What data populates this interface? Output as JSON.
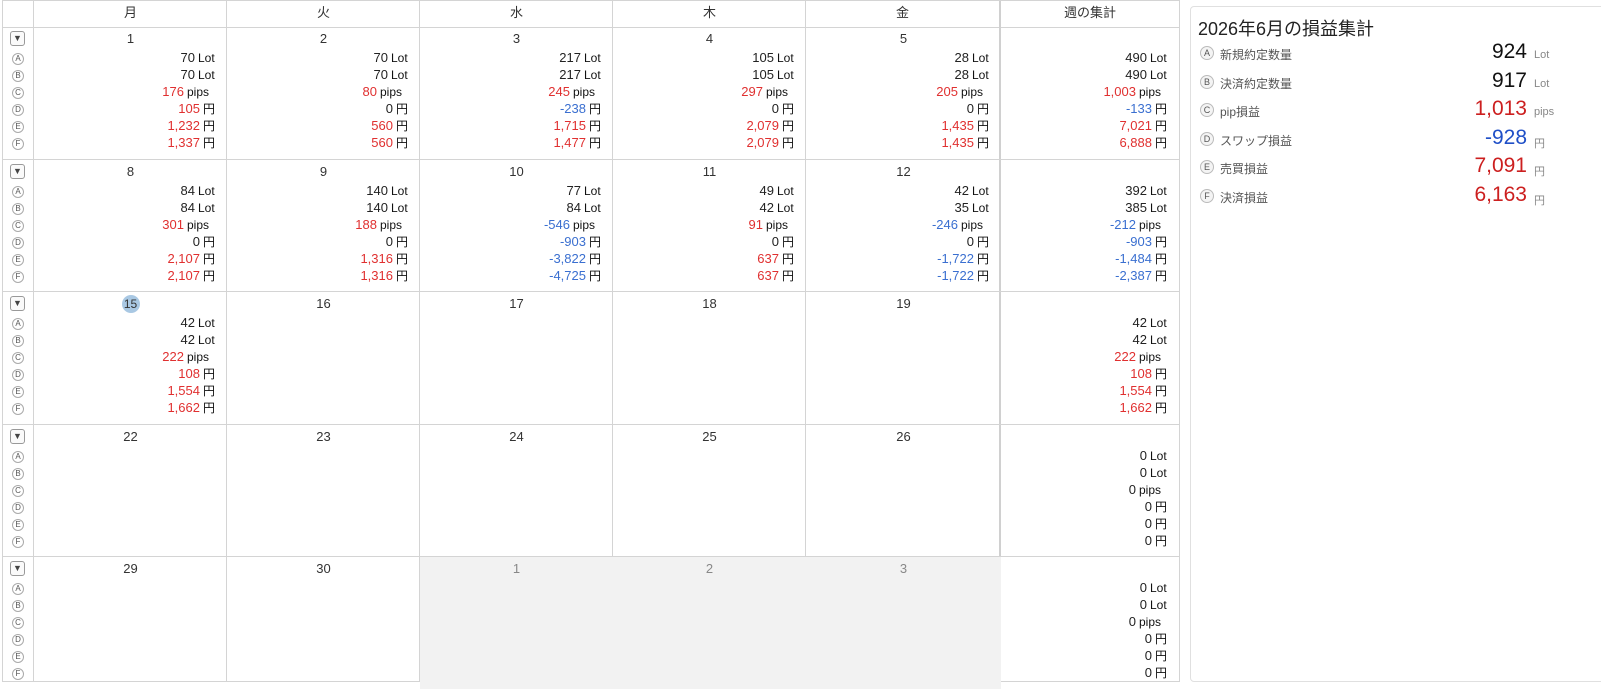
{
  "weekday_headers": [
    "月",
    "火",
    "水",
    "木",
    "金"
  ],
  "weekly_total_header": "週の集計",
  "row_badges": [
    "A",
    "B",
    "C",
    "D",
    "E",
    "F"
  ],
  "toggle_icon": "▼",
  "units": [
    "Lot",
    "Lot",
    "pips",
    "円",
    "円",
    "円"
  ],
  "colors": {
    "positive": "#e03030",
    "negative": "#3a6fd0",
    "neutral": "#222222",
    "today": "#a9c8e3",
    "out_of_month": "#f2f2f2"
  },
  "weeks": [
    {
      "days": [
        {
          "day": "1",
          "vals": [
            "70",
            "70",
            "176",
            "105",
            "1,232",
            "1,337"
          ]
        },
        {
          "day": "2",
          "vals": [
            "70",
            "70",
            "80",
            "0",
            "560",
            "560"
          ]
        },
        {
          "day": "3",
          "vals": [
            "217",
            "217",
            "245",
            "-238",
            "1,715",
            "1,477"
          ]
        },
        {
          "day": "4",
          "vals": [
            "105",
            "105",
            "297",
            "0",
            "2,079",
            "2,079"
          ]
        },
        {
          "day": "5",
          "vals": [
            "28",
            "28",
            "205",
            "0",
            "1,435",
            "1,435"
          ]
        }
      ],
      "total": [
        "490",
        "490",
        "1,003",
        "-133",
        "7,021",
        "6,888"
      ]
    },
    {
      "days": [
        {
          "day": "8",
          "vals": [
            "84",
            "84",
            "301",
            "0",
            "2,107",
            "2,107"
          ]
        },
        {
          "day": "9",
          "vals": [
            "140",
            "140",
            "188",
            "0",
            "1,316",
            "1,316"
          ]
        },
        {
          "day": "10",
          "vals": [
            "77",
            "84",
            "-546",
            "-903",
            "-3,822",
            "-4,725"
          ]
        },
        {
          "day": "11",
          "vals": [
            "49",
            "42",
            "91",
            "0",
            "637",
            "637"
          ]
        },
        {
          "day": "12",
          "vals": [
            "42",
            "35",
            "-246",
            "0",
            "-1,722",
            "-1,722"
          ]
        }
      ],
      "total": [
        "392",
        "385",
        "-212",
        "-903",
        "-1,484",
        "-2,387"
      ]
    },
    {
      "days": [
        {
          "day": "15",
          "today": true,
          "vals": [
            "42",
            "42",
            "222",
            "108",
            "1,554",
            "1,662"
          ]
        },
        {
          "day": "16"
        },
        {
          "day": "17"
        },
        {
          "day": "18"
        },
        {
          "day": "19"
        }
      ],
      "total": [
        "42",
        "42",
        "222",
        "108",
        "1,554",
        "1,662"
      ]
    },
    {
      "days": [
        {
          "day": "22"
        },
        {
          "day": "23"
        },
        {
          "day": "24"
        },
        {
          "day": "25"
        },
        {
          "day": "26"
        }
      ],
      "total": [
        "0",
        "0",
        "0",
        "0",
        "0",
        "0"
      ]
    },
    {
      "days": [
        {
          "day": "29"
        },
        {
          "day": "30"
        },
        {
          "day": "1",
          "out": true
        },
        {
          "day": "2",
          "out": true
        },
        {
          "day": "3",
          "out": true
        }
      ],
      "total": [
        "0",
        "0",
        "0",
        "0",
        "0",
        "0"
      ]
    }
  ],
  "summary": {
    "title": "2026年6月の損益集計",
    "rows": [
      {
        "badge": "A",
        "label": "新規約定数量",
        "value": "924",
        "unit": "Lot",
        "tone": "neutral"
      },
      {
        "badge": "B",
        "label": "決済約定数量",
        "value": "917",
        "unit": "Lot",
        "tone": "neutral"
      },
      {
        "badge": "C",
        "label": "pip損益",
        "value": "1,013",
        "unit": "pips",
        "tone": "positive"
      },
      {
        "badge": "D",
        "label": "スワップ損益",
        "value": "-928",
        "unit": "円",
        "tone": "negative"
      },
      {
        "badge": "E",
        "label": "売買損益",
        "value": "7,091",
        "unit": "円",
        "tone": "positive"
      },
      {
        "badge": "F",
        "label": "決済損益",
        "value": "6,163",
        "unit": "円",
        "tone": "positive"
      }
    ]
  }
}
